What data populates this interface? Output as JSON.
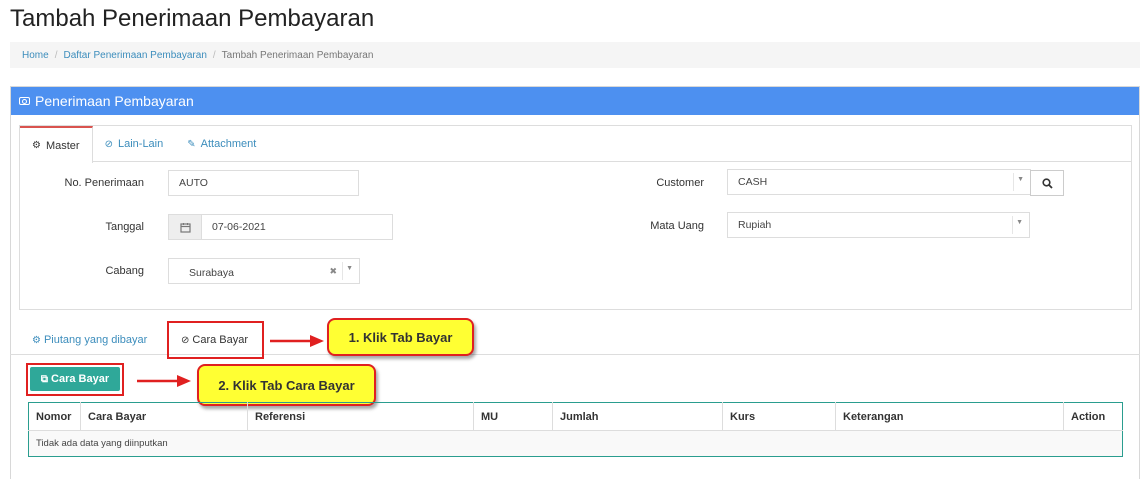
{
  "page": {
    "title": "Tambah Penerimaan Pembayaran"
  },
  "breadcrumb": {
    "items": [
      {
        "label": "Home"
      },
      {
        "label": "Daftar Penerimaan Pembayaran"
      }
    ],
    "current": "Tambah Penerimaan Pembayaran"
  },
  "panel": {
    "title": "Penerimaan Pembayaran",
    "icon": "money-icon"
  },
  "tabs": [
    {
      "label": "Master",
      "icon": "cogs-icon",
      "active": true
    },
    {
      "label": "Lain-Lain",
      "icon": "check-circle-icon",
      "active": false
    },
    {
      "label": "Attachment",
      "icon": "paperclip-icon",
      "active": false
    }
  ],
  "form": {
    "no_penerimaan": {
      "label": "No. Penerimaan",
      "value": "AUTO"
    },
    "tanggal": {
      "label": "Tanggal",
      "value": "07-06-2021",
      "icon": "calendar-icon"
    },
    "cabang": {
      "label": "Cabang",
      "value": "Surabaya"
    },
    "customer": {
      "label": "Customer",
      "value": "CASH",
      "button_icon": "search-icon"
    },
    "mata_uang": {
      "label": "Mata Uang",
      "value": "Rupiah"
    }
  },
  "subtabs": [
    {
      "label": "Piutang yang dibayar",
      "icon": "cogs-icon"
    },
    {
      "label": "Cara Bayar",
      "icon": "check-circle-icon"
    }
  ],
  "callouts": {
    "step1": "1. Klik Tab Bayar",
    "step2": "2. Klik Tab Cara Bayar"
  },
  "button": {
    "label": "Cara Bayar",
    "icon": "copy-icon"
  },
  "table": {
    "columns": [
      "Nomor",
      "Cara Bayar",
      "Referensi",
      "MU",
      "Jumlah",
      "Kurs",
      "Keterangan",
      "Action"
    ],
    "empty_text": "Tidak ada data yang diinputkan"
  },
  "colors": {
    "panel_header": "#4d90f0",
    "button": "#2fa899",
    "callout": "#ffff33",
    "highlight": "#e02020",
    "link": "#3c8dbc"
  }
}
